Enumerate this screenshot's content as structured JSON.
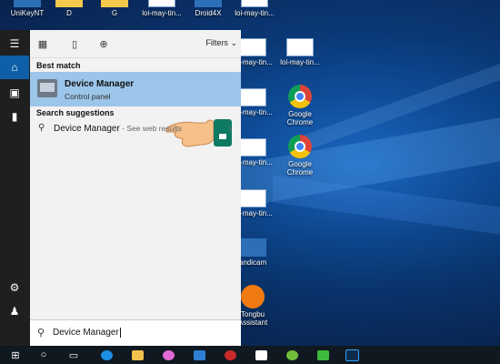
{
  "desktop": {
    "top_icons": [
      "UniKeyNT",
      "D",
      "G",
      "loi-may-tin...",
      "Droid4X",
      "loi-may-tin..."
    ],
    "side_icons": [
      {
        "label": "loi-may-tin...",
        "type": "doc"
      },
      {
        "label": "loi-may-tin...",
        "type": "doc"
      },
      {
        "label": "loi-may-tin...",
        "type": "doc"
      },
      {
        "label": "Google Chrome",
        "type": "chrome"
      },
      {
        "label": "loi-may-tin...",
        "type": "doc"
      },
      {
        "label": "Google Chrome",
        "type": "chrome"
      },
      {
        "label": "loi-may-tin...",
        "type": "doc"
      },
      {
        "label": "andicam",
        "type": "blue"
      },
      {
        "label": "Tongbu Assistant",
        "type": "orange"
      }
    ]
  },
  "start_menu": {
    "filters_label": "Filters",
    "best_match_title": "Best match",
    "best_match": {
      "title": "Device Manager",
      "subtitle": "Control panel"
    },
    "suggestions_title": "Search suggestions",
    "suggestion": {
      "text": "Device Manager",
      "suffix": " - See web results"
    },
    "search_value": "Device Manager"
  },
  "colors": {
    "accent": "#0f5fa8",
    "best_match_bg": "#9cc5ea"
  }
}
